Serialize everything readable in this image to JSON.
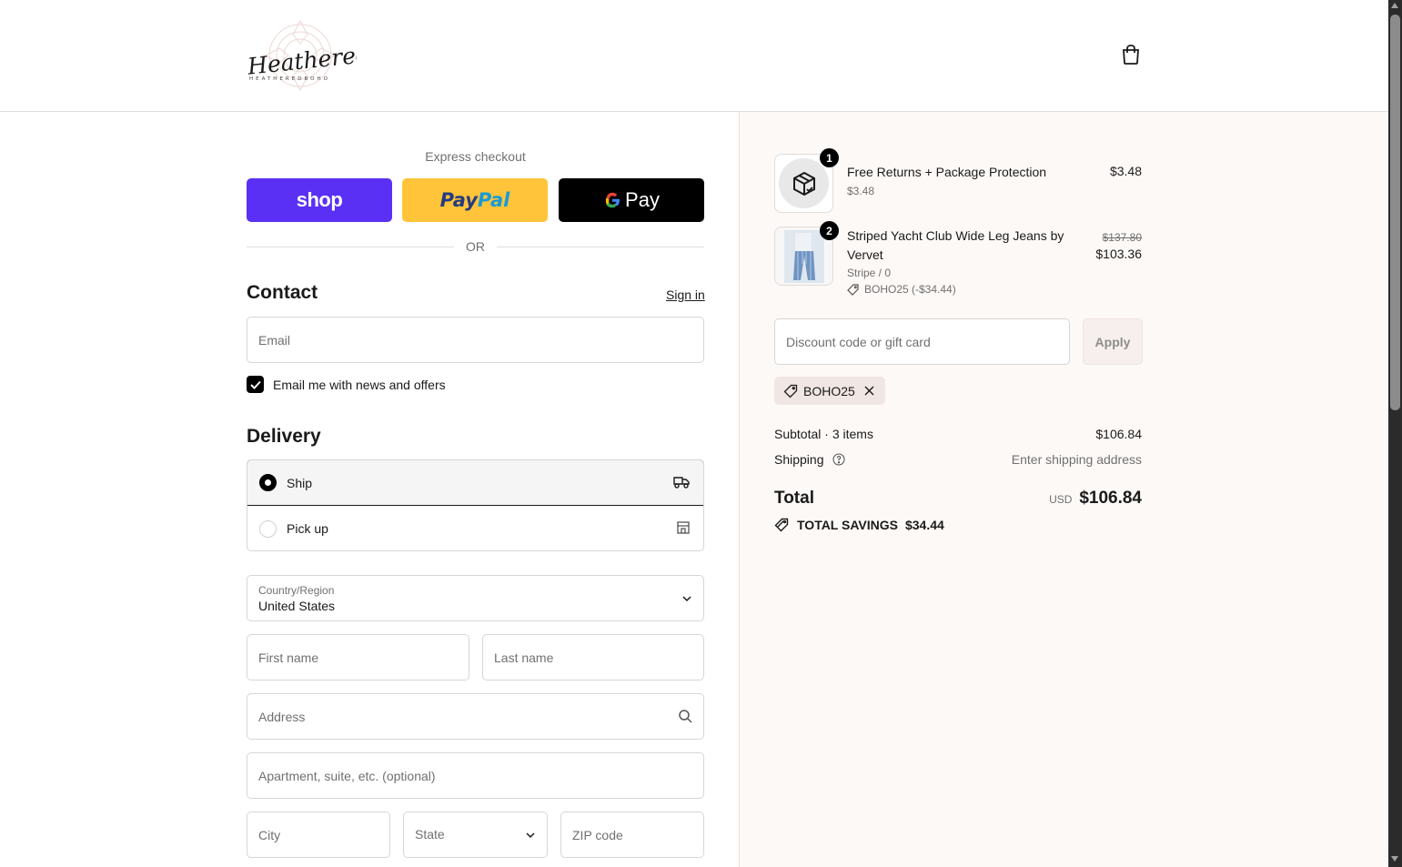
{
  "header": {
    "logo_text": "Heathered Boho",
    "logo_subtext": "HEATHEREDBOHO",
    "cart_icon": "shopping-bag-icon"
  },
  "express": {
    "label": "Express checkout",
    "shop_label": "shop",
    "paypal_label": "PayPal",
    "gpay_label": "Pay",
    "or_label": "OR"
  },
  "contact": {
    "title": "Contact",
    "sign_in": "Sign in",
    "email_placeholder": "Email",
    "newsletter_label": "Email me with news and offers",
    "newsletter_checked": true
  },
  "delivery": {
    "title": "Delivery",
    "options": [
      {
        "label": "Ship",
        "selected": true,
        "icon": "truck-icon"
      },
      {
        "label": "Pick up",
        "selected": false,
        "icon": "store-icon"
      }
    ],
    "country_label": "Country/Region",
    "country_value": "United States",
    "first_name_placeholder": "First name",
    "last_name_placeholder": "Last name",
    "address_placeholder": "Address",
    "apartment_placeholder": "Apartment, suite, etc. (optional)",
    "city_placeholder": "City",
    "state_placeholder": "State",
    "zip_placeholder": "ZIP code"
  },
  "order": {
    "items": [
      {
        "qty": "1",
        "title": "Free Returns + Package Protection",
        "sub": "$3.48",
        "price": "$3.48"
      },
      {
        "qty": "2",
        "title_line1": "Striped Yacht Club Wide Leg Jeans by",
        "title_line2": "Vervet",
        "variant": "Stripe / 0",
        "discount": "BOHO25 (-$34.44)",
        "old_price": "$137.80",
        "price": "$103.36"
      }
    ],
    "discount_placeholder": "Discount code or gift card",
    "apply_label": "Apply",
    "applied_code": "BOHO25",
    "subtotal_label": "Subtotal · 3 items",
    "subtotal_value": "$106.84",
    "shipping_label": "Shipping",
    "shipping_value": "Enter shipping address",
    "total_label": "Total",
    "total_currency": "USD",
    "total_value": "$106.84",
    "savings_label": "TOTAL SAVINGS",
    "savings_value": "$34.44"
  }
}
